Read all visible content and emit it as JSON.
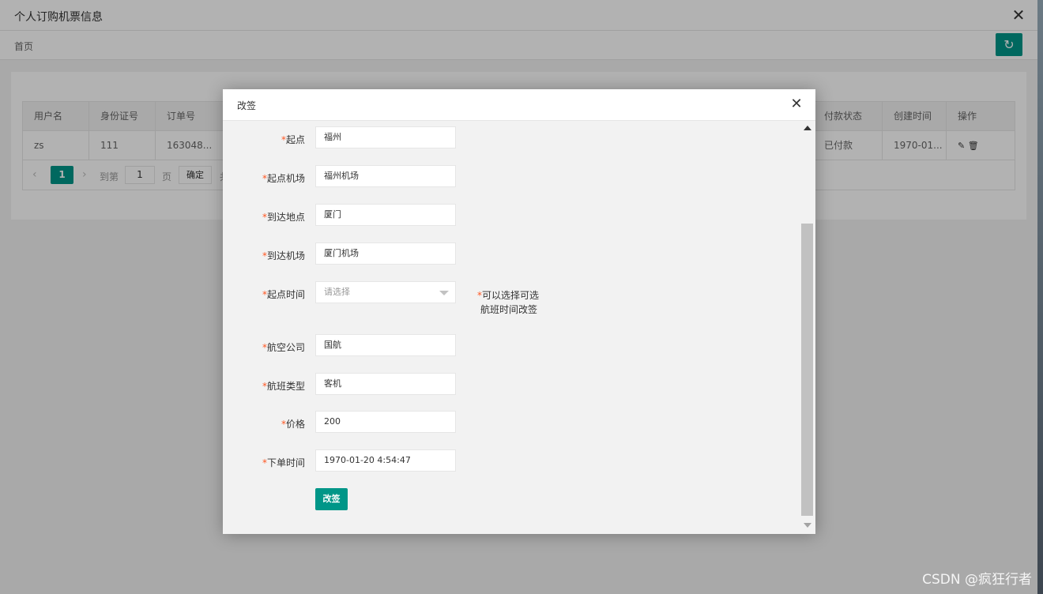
{
  "window": {
    "title": "个人订购机票信息"
  },
  "breadcrumb": {
    "home": "首页"
  },
  "table": {
    "headers": {
      "username": "用户名",
      "id_number": "身份证号",
      "order_number": "订单号",
      "pay_status": "付款状态",
      "created_time": "创建时间",
      "actions": "操作"
    },
    "row": {
      "username": "zs",
      "id_number": "111",
      "order_number": "163048...",
      "pay_status": "已付款",
      "created_time": "1970-01..."
    },
    "action_icons": [
      "edit-icon",
      "delete-icon"
    ]
  },
  "pager": {
    "current": "1",
    "goto_label": "到第",
    "goto_value": "1",
    "page_label": "页",
    "confirm": "确定",
    "total_partial": "共"
  },
  "modal": {
    "title": "改签",
    "fields": [
      {
        "label": "起点",
        "value": "福州"
      },
      {
        "label": "起点机场",
        "value": "福州机场"
      },
      {
        "label": "到达地点",
        "value": "厦门"
      },
      {
        "label": "到达机场",
        "value": "厦门机场"
      },
      {
        "label": "起点时间",
        "placeholder": "请选择"
      },
      {
        "label": "航空公司",
        "value": "国航"
      },
      {
        "label": "航班类型",
        "value": "客机"
      },
      {
        "label": "价格",
        "value": "200"
      },
      {
        "label": "下单时间",
        "value": "1970-01-20 4:54:47"
      }
    ],
    "required_mark": "*",
    "hint_line1": "可以选择可选",
    "hint_line2": "航班时间改签",
    "submit": "改签"
  },
  "watermark": "CSDN @疯狂行者",
  "colors": {
    "accent": "#009688",
    "required": "#ff5722"
  }
}
